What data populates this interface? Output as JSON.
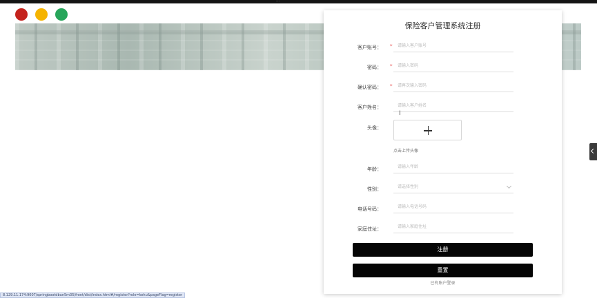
{
  "window": {
    "topbar_text": "... ",
    "status_url": "8.129.11.174:9007/springbootdbun5m35/front/dist/index.html#/register?role=kehu&pageFlag=register"
  },
  "form": {
    "title": "保险客户管理系统注册",
    "fields": [
      {
        "label": "客户账号：",
        "required": true,
        "placeholder": "请输入客户账号"
      },
      {
        "label": "密码：",
        "required": true,
        "placeholder": "请输入密码"
      },
      {
        "label": "确认密码：",
        "required": true,
        "placeholder": "请再次输入密码"
      },
      {
        "label": "客户姓名：",
        "required": false,
        "placeholder": "请输入客户姓名"
      },
      {
        "label": "年龄：",
        "required": false,
        "placeholder": "请输入年龄"
      },
      {
        "label": "性别：",
        "required": false,
        "placeholder": "请选择性别"
      },
      {
        "label": "电话号码：",
        "required": false,
        "placeholder": "请输入电话号码"
      },
      {
        "label": "家庭住址：",
        "required": false,
        "placeholder": "请输入家庭住址"
      }
    ],
    "avatar": {
      "label": "头像：",
      "hint": "点击上传头像"
    },
    "required_mark": "*",
    "register_button": "注册",
    "reset_button": "重置",
    "login_link": "已有账户登录"
  },
  "cursor_glyph": "I"
}
